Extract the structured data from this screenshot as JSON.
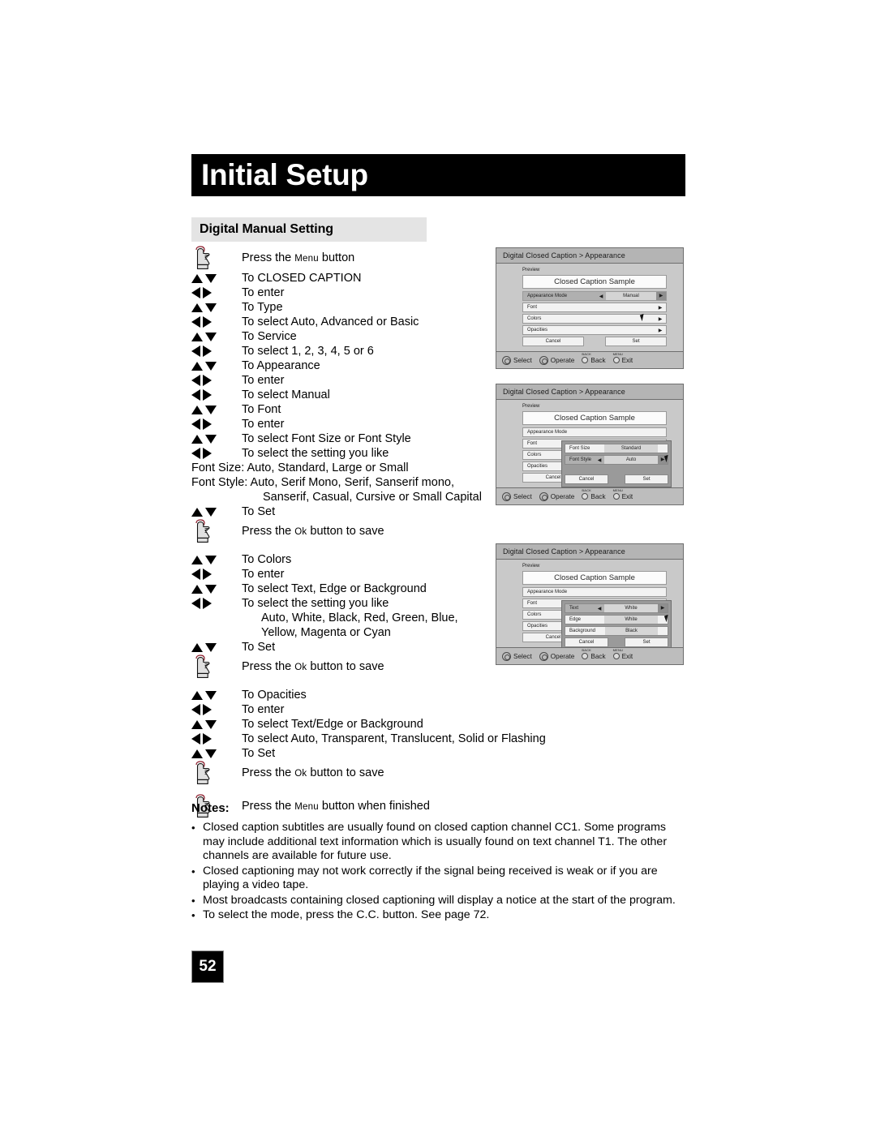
{
  "page": {
    "title": "Initial Setup",
    "section_title": "Digital Manual Setting",
    "page_number": "52"
  },
  "steps": [
    {
      "key": "hand",
      "label_pre": "Press the ",
      "label_sc": "Menu",
      "label_post": " button"
    },
    {
      "key": "updown",
      "label": "To CLOSED CAPTION"
    },
    {
      "key": "leftright",
      "label": "To enter"
    },
    {
      "key": "updown",
      "label": "To Type"
    },
    {
      "key": "leftright",
      "label": "To select Auto, Advanced or Basic"
    },
    {
      "key": "updown",
      "label": "To Service"
    },
    {
      "key": "leftright",
      "label": "To select 1, 2, 3, 4, 5 or 6"
    },
    {
      "key": "updown",
      "label": "To Appearance"
    },
    {
      "key": "leftright",
      "label": "To enter"
    },
    {
      "key": "leftright",
      "label": "To select Manual"
    },
    {
      "key": "updown",
      "label": "To Font"
    },
    {
      "key": "leftright",
      "label": "To enter"
    },
    {
      "key": "updown",
      "label": "To select Font Size or Font Style"
    },
    {
      "key": "leftright",
      "label": "To select the setting you like"
    }
  ],
  "font_notes": {
    "size_line": "Font Size: Auto, Standard, Large or Small",
    "style_line1": "Font Style: Auto, Serif Mono, Serif, Sanserif mono,",
    "style_line2": "Sanserif, Casual, Cursive or Small Capital"
  },
  "steps2": [
    {
      "key": "updown",
      "label": "To Set"
    },
    {
      "key": "hand",
      "label_pre": "Press the ",
      "label_sc": "Ok",
      "label_post": " button to save"
    }
  ],
  "steps3": [
    {
      "key": "updown",
      "label": "To Colors"
    },
    {
      "key": "leftright",
      "label": "To enter"
    },
    {
      "key": "updown",
      "label": "To select Text, Edge or Background"
    },
    {
      "key": "leftright",
      "label": "To select the setting you like"
    }
  ],
  "color_notes": {
    "line1": "Auto, White, Black, Red, Green, Blue,",
    "line2": "Yellow, Magenta or Cyan"
  },
  "steps4": [
    {
      "key": "updown",
      "label": "To Set"
    },
    {
      "key": "hand",
      "label_pre": "Press the ",
      "label_sc": "Ok",
      "label_post": " button to save"
    }
  ],
  "steps5": [
    {
      "key": "updown",
      "label": "To Opacities"
    },
    {
      "key": "leftright",
      "label": "To enter"
    },
    {
      "key": "updown",
      "label": "To select Text/Edge or Background"
    },
    {
      "key": "leftright",
      "label": "To select Auto, Transparent, Translucent, Solid or Flashing"
    },
    {
      "key": "updown",
      "label": "To Set"
    },
    {
      "key": "hand",
      "label_pre": "Press the ",
      "label_sc": "Ok",
      "label_post": " button to save"
    }
  ],
  "steps6": [
    {
      "key": "hand",
      "label_pre": "Press the ",
      "label_sc": "Menu",
      "label_post": " button when finished"
    }
  ],
  "notes": {
    "heading": "Notes:",
    "items": [
      "Closed caption subtitles are usually found on closed caption channel CC1. Some programs may include additional text information which is usually found on text channel T1. The other channels are available for future use.",
      "Closed captioning may not work correctly if the signal being received is weak or if you are playing a video tape.",
      "Most broadcasts containing closed captioning will display a notice at the start of the program.",
      "To select the mode, press the C.C. button. See page 72."
    ]
  },
  "osd": {
    "title": "Digital Closed Caption  >  Appearance",
    "preview_label": "Preview",
    "sample_text": "Closed Caption Sample",
    "rows": [
      {
        "name": "Appearance Mode",
        "value": "Manual"
      },
      {
        "name": "Font",
        "value": ""
      },
      {
        "name": "Colors",
        "value": ""
      },
      {
        "name": "Opacities",
        "value": ""
      }
    ],
    "cancel_label": "Cancel",
    "set_label": "Set",
    "footer": {
      "select": "Select",
      "operate": "Operate",
      "back": "Back",
      "back_tag": "BACK",
      "exit": "Exit",
      "exit_tag": "MENU"
    }
  },
  "osd2_overlay": {
    "rows": [
      {
        "name": "Font Size",
        "value": "Standard"
      },
      {
        "name": "Font Style",
        "value": "Auto"
      }
    ],
    "cancel_label": "Cancel",
    "set_label": "Set"
  },
  "osd3_overlay": {
    "rows": [
      {
        "name": "Text",
        "value": "White"
      },
      {
        "name": "Edge",
        "value": "White"
      },
      {
        "name": "Background",
        "value": "Black"
      }
    ],
    "cancel_label": "Cancel",
    "set_label": "Set"
  },
  "colors": {
    "banner_bg": "#000000",
    "section_bg": "#e4e4e4",
    "osd_bg": "#c9c9c9",
    "osd_title_bg": "#b4b4b4",
    "osd_row_bg": "#f2f2f2",
    "osd_selected_bg": "#b0b0b0"
  }
}
